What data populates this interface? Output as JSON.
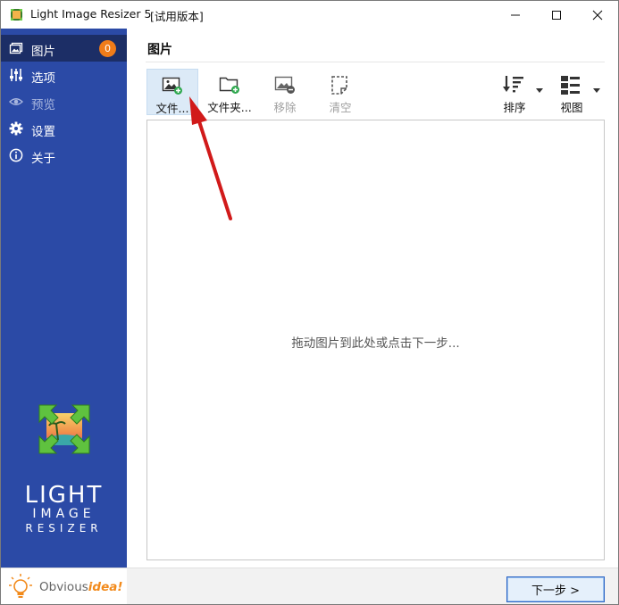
{
  "window": {
    "title": "Light Image Resizer 5",
    "title_suffix": "[试用版本]"
  },
  "sidebar": {
    "items": [
      {
        "label": "图片",
        "badge": "0",
        "icon": "images-icon",
        "active": true
      },
      {
        "label": "选项",
        "icon": "sliders-icon"
      },
      {
        "label": "预览",
        "icon": "eye-icon",
        "disabled": true
      },
      {
        "label": "设置",
        "icon": "gear-icon"
      },
      {
        "label": "关于",
        "icon": "info-icon"
      }
    ],
    "logo": {
      "line1": "LIGHT",
      "line2": "IMAGE",
      "line3": "RESIZER"
    },
    "brand": {
      "prefix": "Obvious",
      "accent": "idea!"
    }
  },
  "main": {
    "title": "图片",
    "toolbar": {
      "add_files": "文件...",
      "add_folder": "文件夹...",
      "remove": "移除",
      "clear": "清空",
      "sort": "排序",
      "view": "视图"
    },
    "drop_hint": "拖动图片到此处或点击下一步...",
    "next_button": "下一步 >"
  },
  "colors": {
    "sidebar_bg": "#2b4aa6",
    "sidebar_active": "#1c2e66",
    "badge": "#f07c19",
    "annotation_arrow": "#d11a1a"
  }
}
